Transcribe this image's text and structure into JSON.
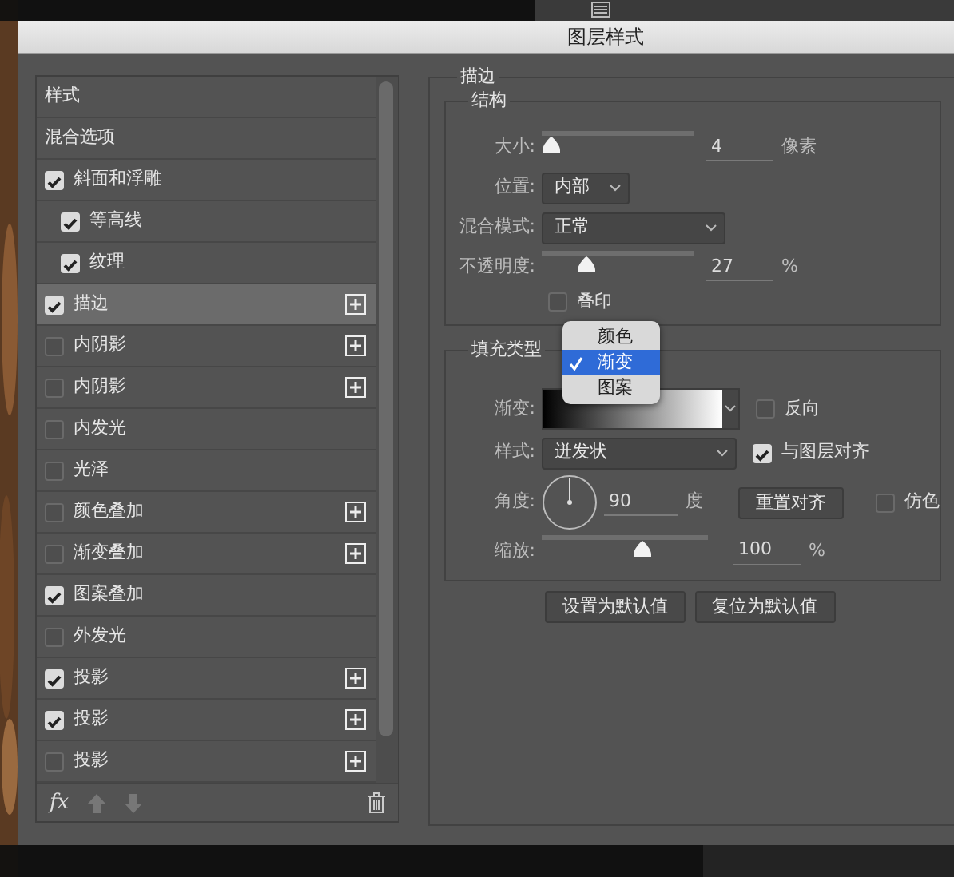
{
  "window": {
    "title": "图层样式"
  },
  "styles_list": {
    "items": [
      {
        "label": "样式",
        "kind": "header",
        "selected": false
      },
      {
        "label": "混合选项",
        "kind": "header",
        "selected": false
      },
      {
        "label": "斜面和浮雕",
        "kind": "check",
        "checked": true,
        "selected": false,
        "add_button": false,
        "children": [
          {
            "label": "等高线",
            "kind": "check",
            "checked": true,
            "selected": false,
            "add_button": false
          },
          {
            "label": "纹理",
            "kind": "check",
            "checked": true,
            "selected": false,
            "add_button": false
          }
        ]
      },
      {
        "label": "描边",
        "kind": "check",
        "checked": true,
        "selected": true,
        "add_button": true
      },
      {
        "label": "内阴影",
        "kind": "check",
        "checked": false,
        "selected": false,
        "add_button": true
      },
      {
        "label": "内阴影",
        "kind": "check",
        "checked": false,
        "selected": false,
        "add_button": true
      },
      {
        "label": "内发光",
        "kind": "check",
        "checked": false,
        "selected": false,
        "add_button": false
      },
      {
        "label": "光泽",
        "kind": "check",
        "checked": false,
        "selected": false,
        "add_button": false
      },
      {
        "label": "颜色叠加",
        "kind": "check",
        "checked": false,
        "selected": false,
        "add_button": true
      },
      {
        "label": "渐变叠加",
        "kind": "check",
        "checked": false,
        "selected": false,
        "add_button": true
      },
      {
        "label": "图案叠加",
        "kind": "check",
        "checked": true,
        "selected": false,
        "add_button": false
      },
      {
        "label": "外发光",
        "kind": "check",
        "checked": false,
        "selected": false,
        "add_button": false
      },
      {
        "label": "投影",
        "kind": "check",
        "checked": true,
        "selected": false,
        "add_button": true
      },
      {
        "label": "投影",
        "kind": "check",
        "checked": true,
        "selected": false,
        "add_button": true
      },
      {
        "label": "投影",
        "kind": "check",
        "checked": false,
        "selected": false,
        "add_button": true
      }
    ],
    "fx_label": "fx"
  },
  "stroke": {
    "title": "描边",
    "structure": {
      "title": "结构",
      "size": {
        "label": "大小:",
        "level": 0.0,
        "value": "4",
        "unit": "像素"
      },
      "position": {
        "label": "位置:",
        "value": "内部"
      },
      "blend_mode": {
        "label": "混合模式:",
        "value": "正常"
      },
      "opacity": {
        "label": "不透明度:",
        "level": 0.27,
        "value": "27",
        "unit": "%"
      },
      "overprint": {
        "label": "叠印",
        "checked": false
      }
    },
    "fill": {
      "title": "填充类型",
      "gradient": {
        "label": "渐变:",
        "reverse": {
          "label": "反向",
          "checked": false
        }
      },
      "style": {
        "label": "样式:",
        "value": "迸发状",
        "align": {
          "label": "与图层对齐",
          "checked": true
        }
      },
      "angle": {
        "label": "角度:",
        "value": "90",
        "unit": "度",
        "reset_button": "重置对齐",
        "dither": {
          "label": "仿色",
          "checked": false
        }
      },
      "scale": {
        "label": "缩放:",
        "level": 0.62,
        "value": "100",
        "unit": "%"
      }
    },
    "fill_type_menu": [
      {
        "label": "颜色",
        "selected": false
      },
      {
        "label": "渐变",
        "selected": true
      },
      {
        "label": "图案",
        "selected": false
      }
    ]
  },
  "buttons": [
    "设置为默认值",
    "复位为默认值"
  ]
}
